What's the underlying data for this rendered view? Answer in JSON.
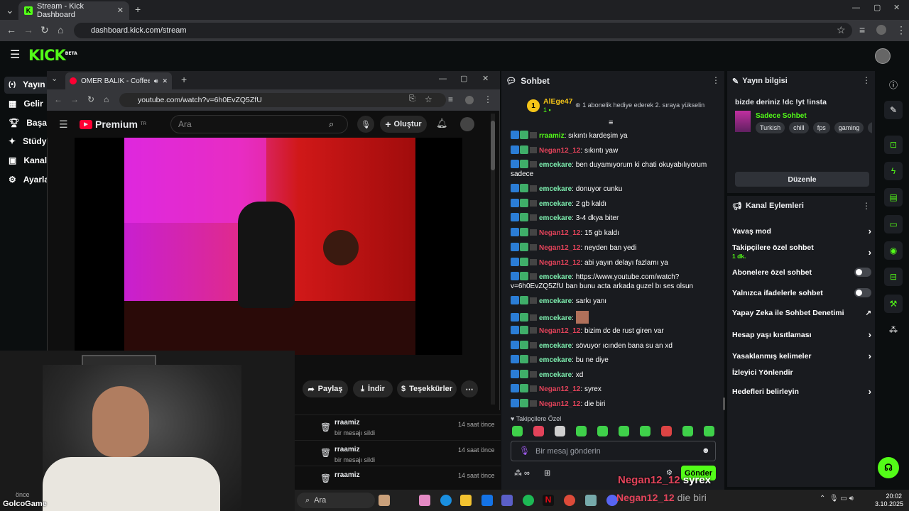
{
  "outer_browser": {
    "tab_title": "Stream - Kick Dashboard",
    "url": "dashboard.kick.com/stream"
  },
  "kick": {
    "logo": "KICK",
    "logo_sup": "BETA",
    "nav": [
      {
        "label": "Yayın",
        "icon": "stream-icon"
      },
      {
        "label": "Gelir",
        "icon": "revenue-icon"
      },
      {
        "label": "Başarı",
        "icon": "trophy-icon"
      },
      {
        "label": "Stüdy",
        "icon": "studio-icon"
      },
      {
        "label": "Kanal",
        "icon": "channel-icon"
      },
      {
        "label": "Ayarla",
        "icon": "settings-icon"
      }
    ]
  },
  "youtube": {
    "tab_title": "OMER BALIK - Coffee Blues",
    "url": "youtube.com/watch?v=6h0EvZQ5ZfU",
    "logo": "Premium",
    "logo_sup": "TR",
    "search_placeholder": "Ara",
    "create_label": "Oluştur",
    "actions": {
      "share": "Paylaş",
      "download": "İndir",
      "thanks": "Teşekkürler"
    },
    "deleted": [
      {
        "user": "rraamiz",
        "text": "bir mesajı sildi",
        "time": "14 saat önce",
        "left_time": "önce"
      },
      {
        "user": "rraamiz",
        "text": "bir mesajı sildi",
        "time": "14 saat önce",
        "left_time": "önce"
      },
      {
        "user": "rraamiz",
        "text": "",
        "time": "14 saat önce",
        "left_time": "önce"
      }
    ]
  },
  "chat": {
    "title": "Sohbet",
    "pinned_user": "AlEge47",
    "pinned_count": "1",
    "rank": "1",
    "pinned_text": "1 abonelik hediye ederek 2. sıraya yükselin",
    "messages": [
      {
        "user": "rraamiz",
        "text": "sıkıntı kardeşim ya",
        "color": "green"
      },
      {
        "user": "Negan12_12",
        "text": "sıkıntı yaw",
        "color": "red"
      },
      {
        "user": "emcekare",
        "text": "ben duyamıyorum ki chati okuyabılıyorum sadece",
        "color": "teal"
      },
      {
        "user": "emcekare",
        "text": "donuyor cunku",
        "color": "teal"
      },
      {
        "user": "emcekare",
        "text": "2 gb kaldı",
        "color": "teal"
      },
      {
        "user": "emcekare",
        "text": "3-4 dkya biter",
        "color": "teal"
      },
      {
        "user": "Negan12_12",
        "text": "15 gb kaldı",
        "color": "red"
      },
      {
        "user": "Negan12_12",
        "text": "neyden ban yedi",
        "color": "red"
      },
      {
        "user": "Negan12_12",
        "text": "abi yayın delayı fazlamı ya",
        "color": "red"
      },
      {
        "user": "emcekare",
        "text": "https://www.youtube.com/watch?v=6h0EvZQ5ZfU ban bunu acta arkada guzel bı ses olsun",
        "color": "teal"
      },
      {
        "user": "emcekare",
        "text": "sarkı yanı",
        "color": "teal"
      },
      {
        "user": "emcekare",
        "text": "",
        "color": "teal"
      },
      {
        "user": "Negan12_12",
        "text": "bizim dc de rust giren var",
        "color": "red"
      },
      {
        "user": "emcekare",
        "text": "sövuyor ıcınden bana su an xd",
        "color": "teal"
      },
      {
        "user": "emcekare",
        "text": "bu ne diye",
        "color": "teal"
      },
      {
        "user": "emcekare",
        "text": "xd",
        "color": "teal"
      },
      {
        "user": "Negan12_12",
        "text": "syrex",
        "color": "red"
      },
      {
        "user": "Negan12_12",
        "text": "die biri",
        "color": "red"
      }
    ],
    "emote_label": "Takipçilere Özel",
    "input_placeholder": "Bir mesaj gönderin",
    "send_label": "Gönder"
  },
  "stream_info": {
    "title": "Yayın bilgisi",
    "stream_title": "bizde deriniz !dc !yt !insta",
    "category": "Sadece Sohbet",
    "tags": [
      "Turkish",
      "chill",
      "fps",
      "gaming",
      "fu"
    ],
    "edit_label": "Düzenle"
  },
  "channel_actions": {
    "title": "Kanal Eylemleri",
    "items": [
      {
        "label": "Yavaş mod",
        "control": "chevron"
      },
      {
        "label": "Takipçilere özel sohbet",
        "sub": "1 dk.",
        "control": "chevron"
      },
      {
        "label": "Abonelere özel sohbet",
        "control": "toggle"
      },
      {
        "label": "Yalnızca ifadelerle sohbet",
        "control": "toggle"
      },
      {
        "label": "Yapay Zeka ile Sohbet Denetimi",
        "control": "external"
      },
      {
        "label": "Hesap yaşı kısıtlaması",
        "control": "chevron"
      },
      {
        "label": "Yasaklanmış kelimeler",
        "control": "chevron"
      },
      {
        "label": "İzleyici Yönlendir",
        "control": "none"
      },
      {
        "label": "Hedefleri belirleyin",
        "control": "chevron"
      }
    ]
  },
  "overlay": {
    "user": "Negan12_12",
    "text": "syrex",
    "text2": "die biri",
    "webcam_label": "GolcoGame"
  },
  "taskbar": {
    "search": "Ara",
    "time": "20:02",
    "date": "3.10.2025"
  },
  "colors": {
    "kick_green": "#53fc18",
    "red_user": "#e3435a"
  }
}
